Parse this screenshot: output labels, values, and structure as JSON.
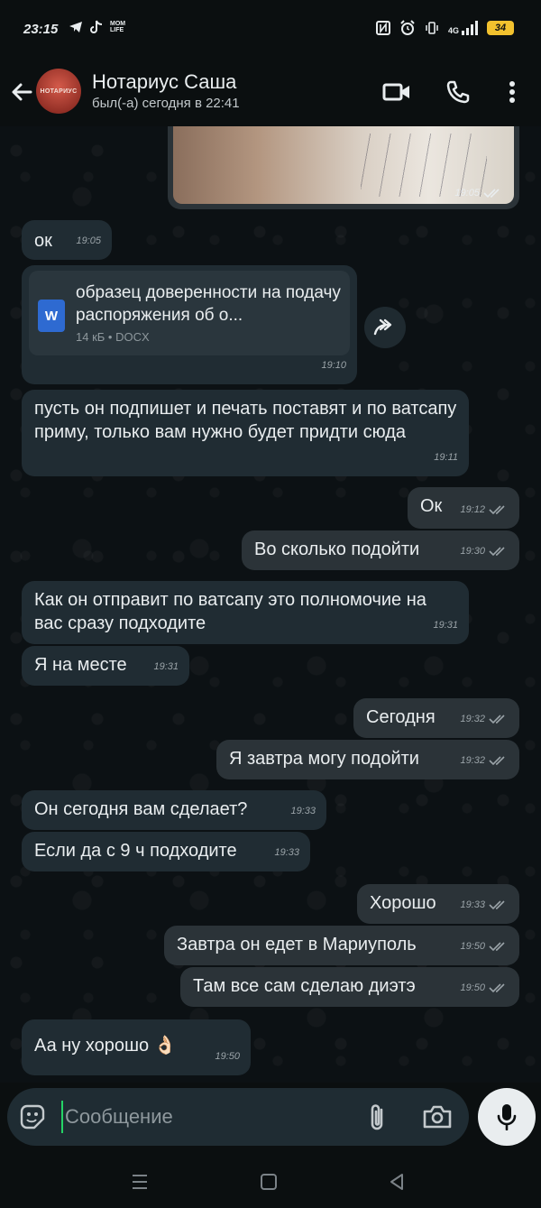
{
  "status_bar": {
    "time": "23:15",
    "left_icons": [
      "telegram-icon",
      "tiktok-icon",
      "mom-life-icon"
    ],
    "mom_life_label": "MOM LIFE",
    "right_icons": [
      "nfc-icon",
      "alarm-icon",
      "vibrate-icon",
      "signal-icon",
      "battery-icon"
    ],
    "network": "4G",
    "battery": "34"
  },
  "header": {
    "contact_name": "Нотариус Саша",
    "last_seen": "был(-а) сегодня в 22:41",
    "avatar_text": "НОТАРИУС",
    "icons": [
      "back-arrow-icon",
      "video-call-icon",
      "phone-icon",
      "more-vert-icon"
    ]
  },
  "colors": {
    "incoming_bubble": "#202c33",
    "outgoing_bubble": "#2b3338",
    "accent": "#25d366",
    "word_blue": "#2e6ad1"
  },
  "messages": {
    "img": {
      "time": "19:05",
      "ticks": "double"
    },
    "ok_in": {
      "text": "ок",
      "time": "19:05"
    },
    "doc": {
      "title": "образец доверенности на подачу распоряжения об о...",
      "size": "14 кБ",
      "type": "DOCX",
      "icon_letter": "W",
      "time": "19:10"
    },
    "m1": {
      "text": "пусть он подпишет и печать поставят и по ватсапу приму, только вам нужно будет придти сюда",
      "time": "19:11"
    },
    "m2": {
      "text": "Ок",
      "time": "19:12"
    },
    "m3": {
      "text": "Во сколько подойти",
      "time": "19:30"
    },
    "m4": {
      "text": "Как он отправит по ватсапу это полномочие на вас сразу подходите",
      "time": "19:31"
    },
    "m5": {
      "text": "Я на месте",
      "time": "19:31"
    },
    "m6": {
      "text": "Сегодня",
      "time": "19:32"
    },
    "m7": {
      "text": "Я завтра могу подойти",
      "time": "19:32"
    },
    "m8": {
      "text": "Он сегодня вам сделает?",
      "time": "19:33"
    },
    "m9": {
      "text": "Если да с 9 ч подходите",
      "time": "19:33"
    },
    "m10": {
      "text": "Хорошо",
      "time": "19:33"
    },
    "m11": {
      "text": "Завтра он едет в Мариуполь",
      "time": "19:50"
    },
    "m12": {
      "text": "Там все сам сделаю диэтэ",
      "time": "19:50"
    },
    "m13": {
      "text": "Аа ну хорошо 👌🏻",
      "time": "19:50"
    }
  },
  "composer": {
    "placeholder": "Сообщение",
    "value": ""
  }
}
